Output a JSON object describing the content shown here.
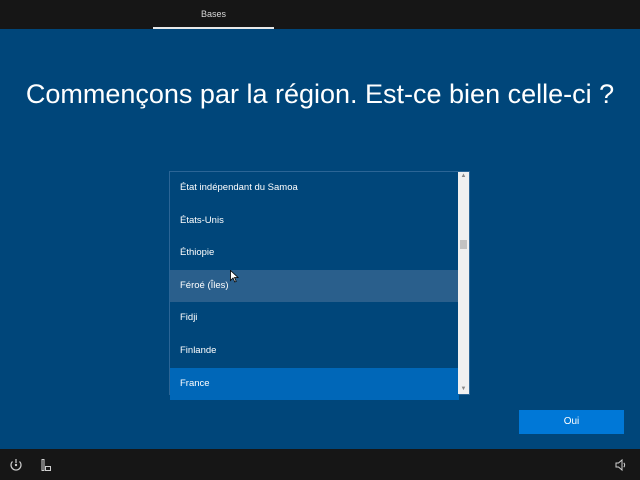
{
  "top_tab": {
    "label": "Bases"
  },
  "heading": "Commençons par la région. Est-ce bien celle-ci ?",
  "region_list": {
    "items": [
      {
        "label": "État indépendant du Samoa",
        "state": "normal"
      },
      {
        "label": "États-Unis",
        "state": "normal"
      },
      {
        "label": "Éthiopie",
        "state": "normal"
      },
      {
        "label": "Féroé (Îles)",
        "state": "hover"
      },
      {
        "label": "Fidji",
        "state": "normal"
      },
      {
        "label": "Finlande",
        "state": "normal"
      },
      {
        "label": "France",
        "state": "selected"
      }
    ]
  },
  "ok_button": {
    "label": "Oui"
  },
  "bottom_bar": {
    "left_icons": [
      "ease-of-access-icon",
      "accessibility-keyboard-icon"
    ],
    "right_icons": [
      "volume-icon"
    ]
  },
  "colors": {
    "background": "#00467a",
    "bar": "#161616",
    "hover_row": "#2a5f8c",
    "selected_row": "#0067b8",
    "accent_button": "#0078d7"
  }
}
